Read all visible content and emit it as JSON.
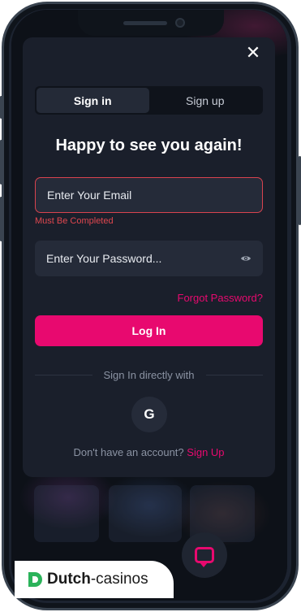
{
  "modal": {
    "close_label": "✕",
    "tabs": [
      {
        "label": "Sign in",
        "active": true
      },
      {
        "label": "Sign up",
        "active": false
      }
    ],
    "heading": "Happy to see you again!",
    "email_placeholder": "Enter Your Email",
    "email_error": "Must Be Completed",
    "password_placeholder": "Enter Your Password...",
    "forgot_label": "Forgot Password?",
    "login_label": "Log In",
    "divider_text": "Sign In directly with",
    "google_label": "G",
    "no_account_text": "Don't have an account?",
    "signup_link": "Sign Up"
  },
  "watermark": {
    "brand_bold": "Dutch",
    "brand_rest": "-casinos"
  },
  "colors": {
    "accent": "#e8096f",
    "error": "#d9434f",
    "modal_bg": "#1a1f2b"
  }
}
